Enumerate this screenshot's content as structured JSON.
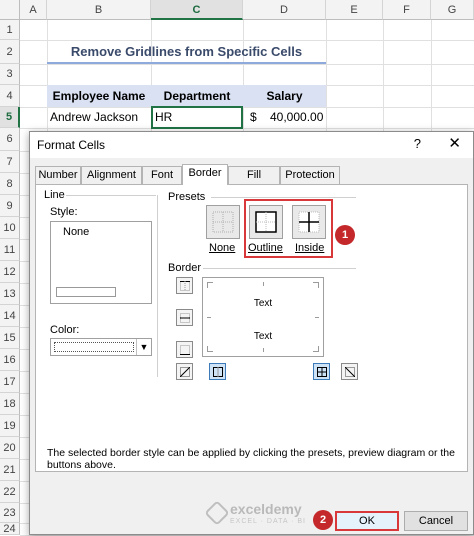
{
  "spreadsheet": {
    "columns": [
      "A",
      "B",
      "C",
      "D",
      "E",
      "F",
      "G"
    ],
    "selected_column": "C",
    "rows": [
      "1",
      "2",
      "3",
      "4",
      "5",
      "6",
      "7",
      "8",
      "9",
      "10",
      "11",
      "12",
      "13",
      "14",
      "15",
      "16",
      "17",
      "18",
      "19",
      "20",
      "21",
      "22",
      "23",
      "24"
    ],
    "selected_row": "5",
    "title": "Remove Gridlines from Specific Cells",
    "headers": [
      "Employee Name",
      "Department",
      "Salary"
    ],
    "row5": {
      "name": "Andrew Jackson",
      "department": "HR",
      "currency": "$",
      "salary": "40,000.00"
    }
  },
  "dialog": {
    "title": "Format Cells",
    "help": "?",
    "close": "✕",
    "tabs": [
      "Number",
      "Alignment",
      "Font",
      "Border",
      "Fill",
      "Protection"
    ],
    "active_tab": "Border",
    "line_group": "Line",
    "style_label": "Style:",
    "style_none": "None",
    "color_label": "Color:",
    "presets_group": "Presets",
    "presets": [
      "None",
      "Outline",
      "Inside"
    ],
    "border_group": "Border",
    "preview_text": [
      "Text",
      "Text"
    ],
    "description": "The selected border style can be applied by clicking the presets, preview diagram or the buttons above.",
    "ok_label": "OK",
    "cancel_label": "Cancel"
  },
  "annotations": {
    "step1": "1",
    "step2": "2",
    "highlight_color": "#d9383a"
  },
  "watermark": {
    "brand": "exceldemy",
    "tagline": "EXCEL · DATA · BI"
  }
}
